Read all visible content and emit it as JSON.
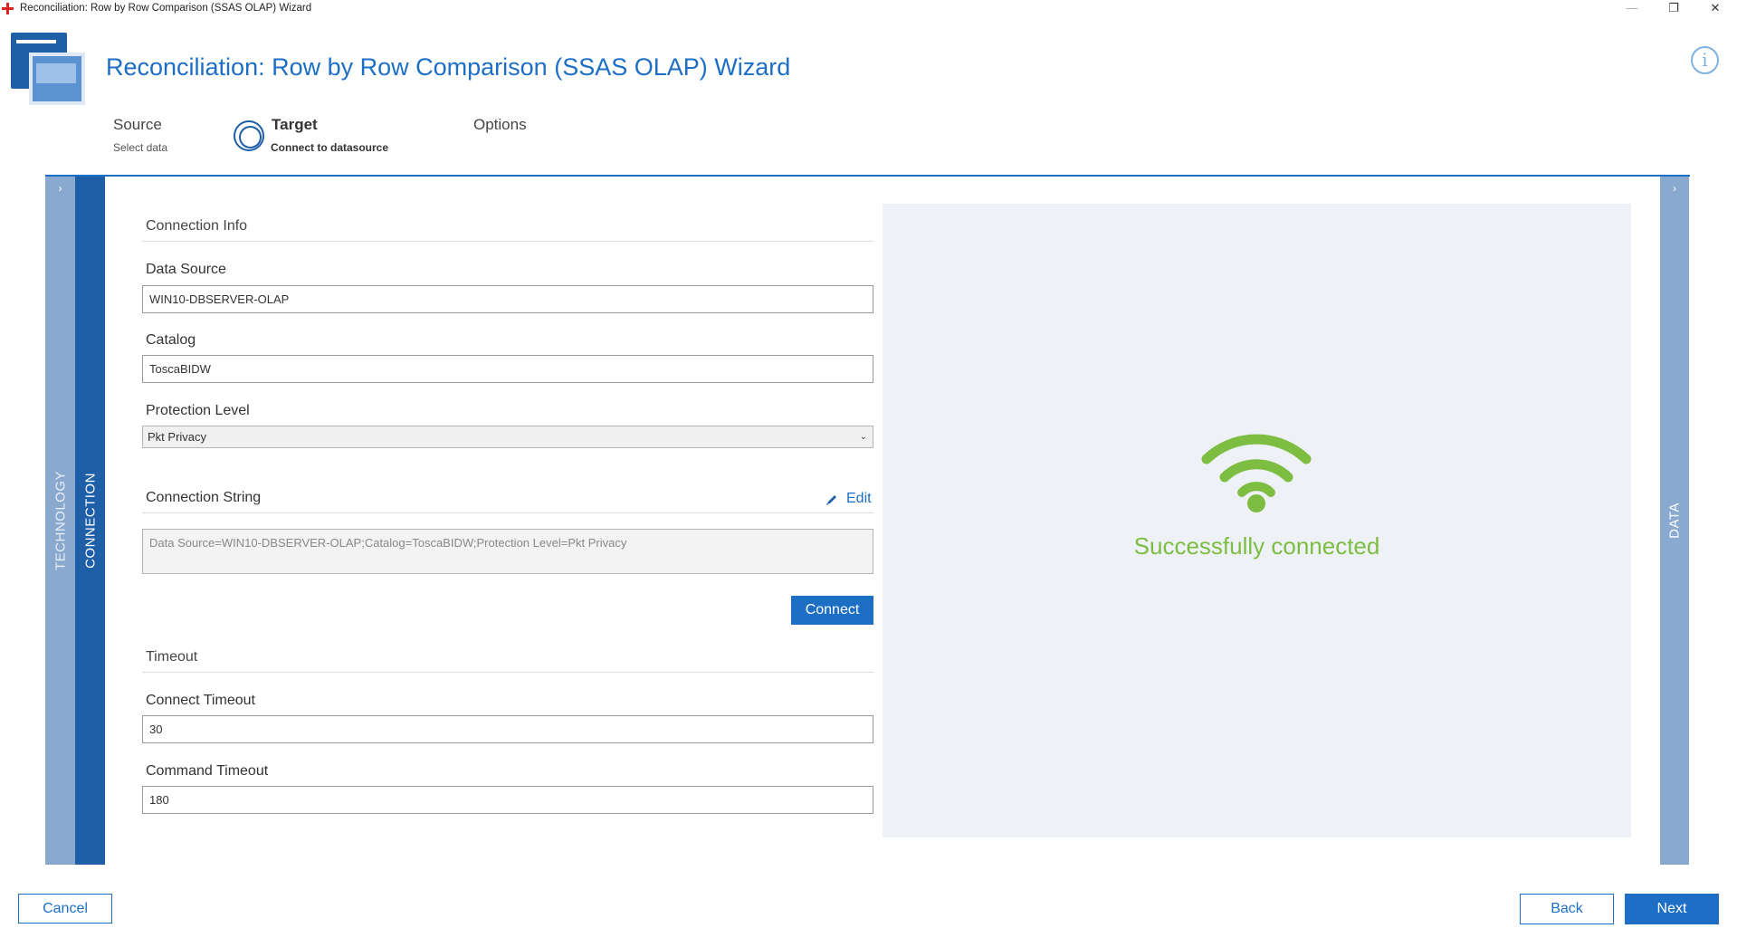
{
  "window": {
    "title": "Reconciliation: Row by Row Comparison (SSAS OLAP) Wizard",
    "controls": {
      "minimize": "—",
      "maximize": "❐",
      "close": "✕"
    }
  },
  "header": {
    "title": "Reconciliation: Row by Row Comparison (SSAS OLAP) Wizard",
    "info_glyph": "i"
  },
  "steps": [
    {
      "title": "Source",
      "subtitle": "Select data"
    },
    {
      "title": "Target",
      "subtitle": "Connect to datasource",
      "active": true
    },
    {
      "title": "Options",
      "subtitle": ""
    }
  ],
  "side_tabs": {
    "technology": "TECHNOLOGY",
    "connection": "CONNECTION",
    "data": "DATA",
    "arrow": "›"
  },
  "form": {
    "connection_info_title": "Connection Info",
    "data_source_label": "Data Source",
    "data_source_value": "WIN10-DBSERVER-OLAP",
    "catalog_label": "Catalog",
    "catalog_value": "ToscaBIDW",
    "protection_level_label": "Protection Level",
    "protection_level_value": "Pkt Privacy",
    "connection_string_label": "Connection String",
    "edit_label": "Edit",
    "connection_string_value": "Data Source=WIN10-DBSERVER-OLAP;Catalog=ToscaBIDW;Protection Level=Pkt Privacy",
    "connect_button": "Connect",
    "timeout_title": "Timeout",
    "connect_timeout_label": "Connect Timeout",
    "connect_timeout_value": "30",
    "command_timeout_label": "Command Timeout",
    "command_timeout_value": "180"
  },
  "status": {
    "message": "Successfully connected",
    "icon": "wifi-icon",
    "color": "#7cbd42"
  },
  "footer": {
    "cancel": "Cancel",
    "back": "Back",
    "next": "Next"
  },
  "colors": {
    "accent": "#1d6fc5",
    "strip_active": "#1f5fa8",
    "strip_inactive": "#8aa9cf",
    "success": "#7cbd42"
  }
}
